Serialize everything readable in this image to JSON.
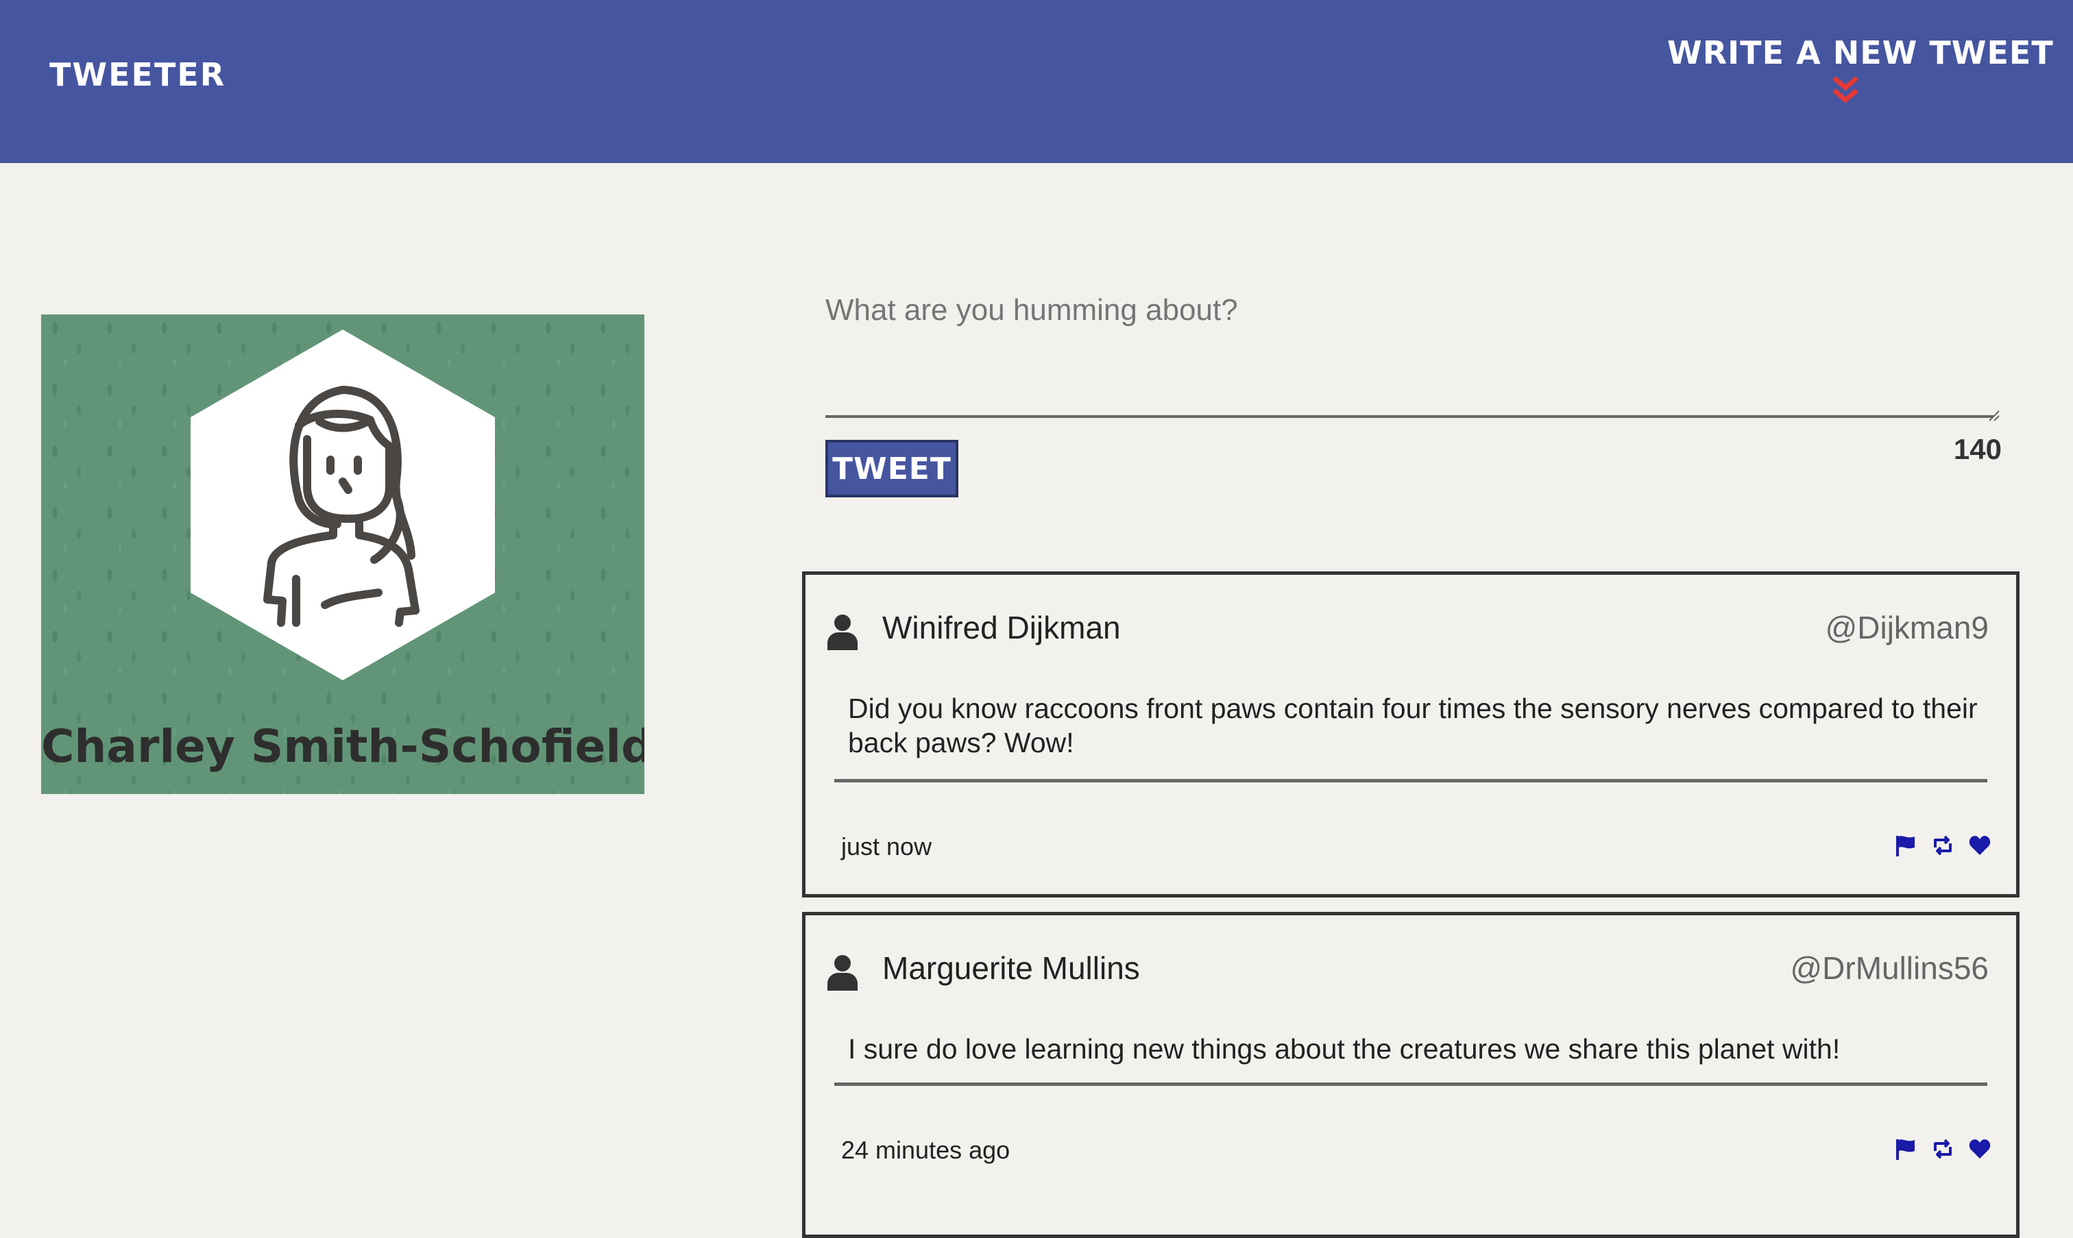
{
  "colors": {
    "nav_background": "#4555a0",
    "page_background": "#f2f1ed",
    "profile_background": "#629577",
    "chevron_accent": "#e53935",
    "action_icon": "#1a1aa8"
  },
  "nav": {
    "brand": "Tweeter",
    "compose_toggle": "Write a new tweet",
    "compose_toggle_icon": "double-chevron-down-icon"
  },
  "profile": {
    "name": "Charley Smith-Schofield",
    "avatar_icon": "woman-avatar-icon"
  },
  "compose": {
    "placeholder": "What are you humming about?",
    "value": "",
    "submit_label": "Tweet",
    "char_counter": "140"
  },
  "tweets": [
    {
      "name": "Winifred Dijkman",
      "handle": "@Dijkman9",
      "text": "Did you know raccoons front paws contain four times the sensory nerves compared to their back paws? Wow!",
      "time": "just now",
      "actions": [
        "flag-icon",
        "retweet-icon",
        "heart-icon"
      ]
    },
    {
      "name": "Marguerite Mullins",
      "handle": "@DrMullins56",
      "text": "I sure do love learning new things about the creatures we share this planet with!",
      "time": "24 minutes ago",
      "actions": [
        "flag-icon",
        "retweet-icon",
        "heart-icon"
      ]
    }
  ]
}
